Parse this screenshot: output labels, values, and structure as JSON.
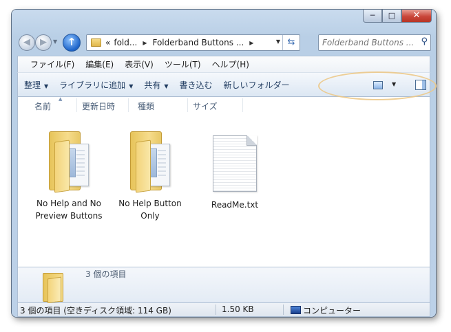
{
  "window": {
    "caption": {
      "minimize": "─",
      "maximize": "□",
      "close": "✕"
    }
  },
  "nav": {
    "back_glyph": "◀",
    "forward_glyph": "▶",
    "up_glyph": "↑",
    "address": [
      "«",
      "fold...",
      "Folderband Buttons ..."
    ],
    "search_placeholder": "Folderband Buttons ..."
  },
  "menubar": [
    "ファイル(F)",
    "編集(E)",
    "表示(V)",
    "ツール(T)",
    "ヘルプ(H)"
  ],
  "toolbar": {
    "organize": "整理",
    "include_in_library": "ライブラリに追加",
    "share": "共有",
    "burn": "書き込む",
    "new_folder": "新しいフォルダー"
  },
  "columns": [
    "名前",
    "更新日時",
    "種類",
    "サイズ"
  ],
  "items": [
    {
      "label": "No Help and No Preview Buttons",
      "icon": "folder-icon"
    },
    {
      "label": "No Help Button Only",
      "icon": "folder-icon"
    },
    {
      "label": "ReadMe.txt",
      "icon": "text-file-icon"
    }
  ],
  "details": {
    "text": "3 個の項目"
  },
  "statusbar": {
    "items": "3 個の項目 (空きディスク領域: 114 GB)",
    "size": "1.50 KB",
    "location": "コンピューター"
  },
  "colors": {
    "frame": "#bcd1e8",
    "highlight_ring": "#ecc98a",
    "up_button": "#1d64c9"
  }
}
